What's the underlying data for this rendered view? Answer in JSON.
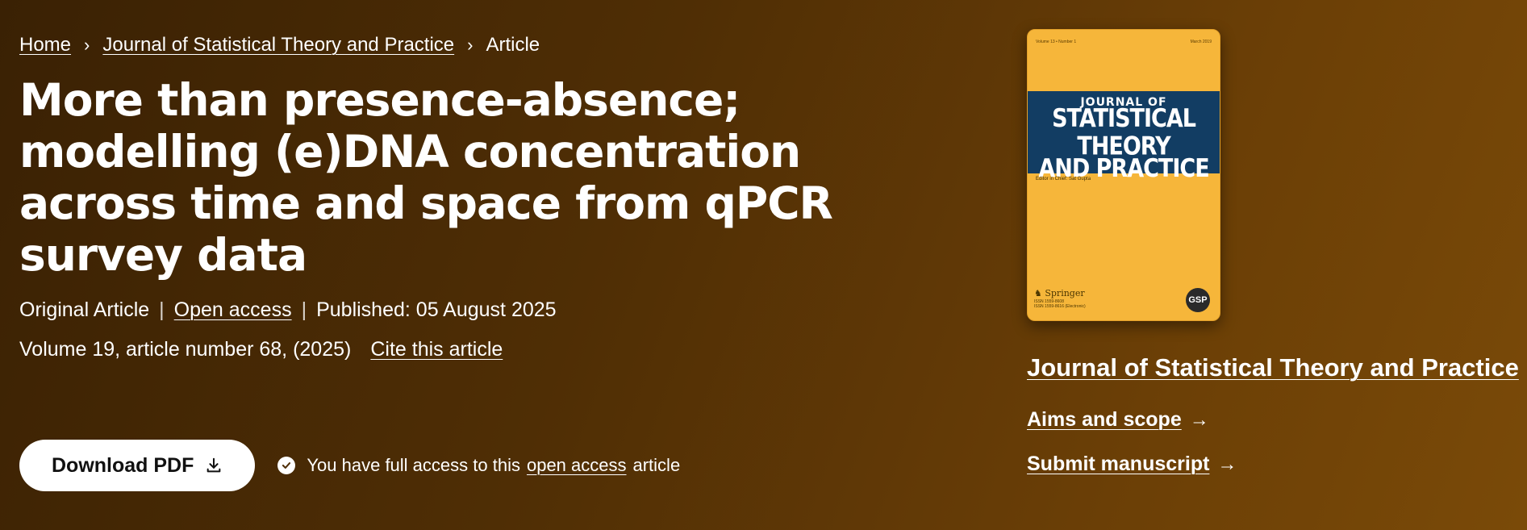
{
  "breadcrumb": {
    "home": "Home",
    "journal": "Journal of Statistical Theory and Practice",
    "current": "Article"
  },
  "article": {
    "title": "More than presence-absence; modelling (e)DNA concentration across time and space from qPCR survey data",
    "type": "Original Article",
    "open_access": "Open access",
    "published": "Published: 05 August 2025",
    "volume": "Volume 19, article number 68, (2025)",
    "cite": "Cite this article"
  },
  "download": {
    "label": "Download PDF",
    "access_prefix": "You have full access to this",
    "access_link": "open access",
    "access_suffix": "article"
  },
  "cover": {
    "top_left": "Volume 13 • Number 1",
    "top_right": "March 2019",
    "line1": "JOURNAL OF",
    "line2": "STATISTICAL THEORY",
    "line3": "AND PRACTICE",
    "editor": "Editor in Chief: Sat Gupta",
    "publisher": "Springer",
    "isbn1": "ISSN 1559-8608",
    "isbn2": "ISSN 1559-8616 (Electronic)",
    "badge": "GSP"
  },
  "sidebar": {
    "journal_title": "Journal of Statistical Theory and Practice",
    "aims": "Aims and scope",
    "submit": "Submit manuscript"
  }
}
